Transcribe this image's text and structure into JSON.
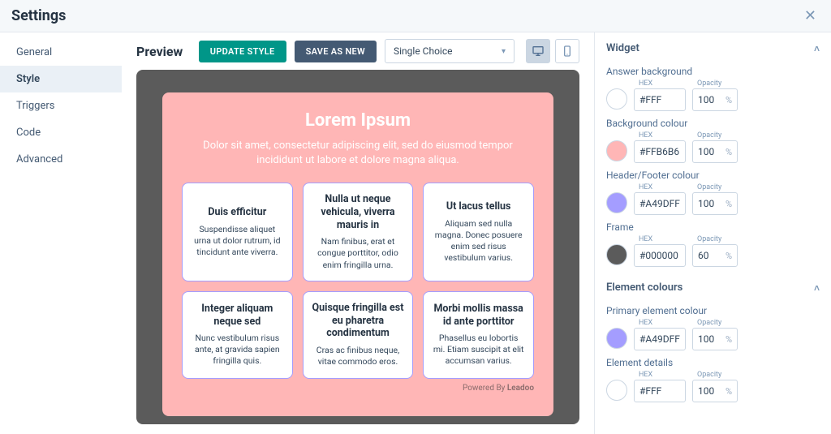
{
  "title": "Settings",
  "sidebar": {
    "items": [
      {
        "label": "General"
      },
      {
        "label": "Style"
      },
      {
        "label": "Triggers"
      },
      {
        "label": "Code"
      },
      {
        "label": "Advanced"
      }
    ]
  },
  "center": {
    "heading": "Preview",
    "update_btn": "UPDATE STYLE",
    "save_btn": "SAVE AS NEW",
    "select_value": "Single Choice"
  },
  "widget": {
    "title": "Lorem Ipsum",
    "subtitle": "Dolor sit amet, consectetur adipiscing elit, sed do eiusmod tempor incididunt ut labore et dolore magna aliqua.",
    "cards": [
      {
        "h": "Duis efficitur",
        "p": "Suspendisse aliquet urna ut dolor rutrum, id tincidunt ante viverra."
      },
      {
        "h": "Nulla ut neque vehicula, viverra mauris in",
        "p": "Nam finibus, erat et congue porttitor, odio enim fringilla urna."
      },
      {
        "h": "Ut lacus tellus",
        "p": "Aliquam sed nulla magna. Donec posuere enim sed risus vestibulum varius."
      },
      {
        "h": "Integer aliquam neque sed",
        "p": "Nunc vestibulum risus ante, at gravida sapien fringilla quis."
      },
      {
        "h": "Quisque fringilla est eu pharetra condimentum",
        "p": "Cras ac finibus neque, vitae commodo eros."
      },
      {
        "h": "Morbi mollis massa id ante porttitor",
        "p": "Phasellus eu lobortis mi. Etiam suscipit at elit accumsan varius."
      }
    ],
    "powered_prefix": "Powered By ",
    "powered_brand": "Leadoo"
  },
  "panel": {
    "labels": {
      "hex": "HEX",
      "opacity": "Opacity",
      "pct": "%"
    },
    "sections": [
      {
        "title": "Widget",
        "fields": [
          {
            "label": "Answer background",
            "swatch": "#FFFFFF",
            "hex": "#FFF",
            "opacity": "100"
          },
          {
            "label": "Background colour",
            "swatch": "#FFB6B6",
            "hex": "#FFB6B6",
            "opacity": "100"
          },
          {
            "label": "Header/Footer colour",
            "swatch": "#A49DFF",
            "hex": "#A49DFF",
            "opacity": "100"
          },
          {
            "label": "Frame",
            "swatch": "#5b5b5b",
            "hex": "#000000",
            "opacity": "60"
          }
        ]
      },
      {
        "title": "Element colours",
        "fields": [
          {
            "label": "Primary element colour",
            "swatch": "#A49DFF",
            "hex": "#A49DFF",
            "opacity": "100"
          },
          {
            "label": "Element details",
            "swatch": "#FFFFFF",
            "hex": "#FFF",
            "opacity": "100"
          }
        ]
      }
    ]
  }
}
